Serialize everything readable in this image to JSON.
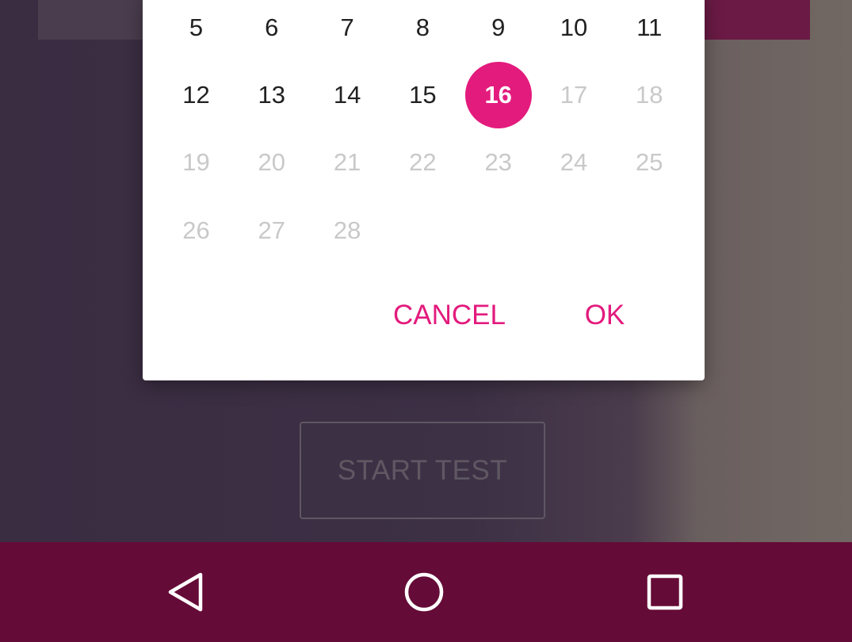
{
  "background": {
    "start_test_label": "START TEST"
  },
  "calendar": {
    "weeks": [
      [
        {
          "day": "5",
          "state": "enabled"
        },
        {
          "day": "6",
          "state": "enabled"
        },
        {
          "day": "7",
          "state": "enabled"
        },
        {
          "day": "8",
          "state": "enabled"
        },
        {
          "day": "9",
          "state": "enabled"
        },
        {
          "day": "10",
          "state": "enabled"
        },
        {
          "day": "11",
          "state": "enabled"
        }
      ],
      [
        {
          "day": "12",
          "state": "enabled"
        },
        {
          "day": "13",
          "state": "enabled"
        },
        {
          "day": "14",
          "state": "enabled"
        },
        {
          "day": "15",
          "state": "enabled"
        },
        {
          "day": "16",
          "state": "selected"
        },
        {
          "day": "17",
          "state": "disabled"
        },
        {
          "day": "18",
          "state": "disabled"
        }
      ],
      [
        {
          "day": "19",
          "state": "disabled"
        },
        {
          "day": "20",
          "state": "disabled"
        },
        {
          "day": "21",
          "state": "disabled"
        },
        {
          "day": "22",
          "state": "disabled"
        },
        {
          "day": "23",
          "state": "disabled"
        },
        {
          "day": "24",
          "state": "disabled"
        },
        {
          "day": "25",
          "state": "disabled"
        }
      ],
      [
        {
          "day": "26",
          "state": "disabled"
        },
        {
          "day": "27",
          "state": "disabled"
        },
        {
          "day": "28",
          "state": "disabled"
        }
      ]
    ],
    "selected_day": "16"
  },
  "dialog": {
    "cancel_label": "CANCEL",
    "ok_label": "OK"
  },
  "nav_bar": {
    "back_icon": "back-triangle-icon",
    "home_icon": "home-circle-icon",
    "recents_icon": "recents-square-icon"
  },
  "colors": {
    "accent": "#e31b7d",
    "nav_bar": "#650b37",
    "disabled_text": "#c9c9c9",
    "enabled_text": "#212121"
  }
}
